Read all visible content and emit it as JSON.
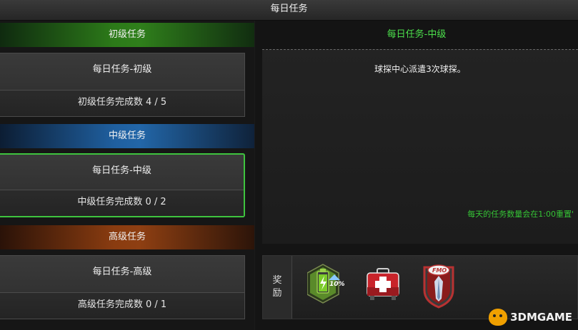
{
  "window": {
    "title": "每日任务"
  },
  "tiers": [
    {
      "header": "初级任务",
      "task_name": "每日任务-初级",
      "progress_label": "初级任务完成数 4 / 5",
      "completed": 4,
      "total": 5,
      "selected": false,
      "color": "#2f7f1b"
    },
    {
      "header": "中级任务",
      "task_name": "每日任务-中级",
      "progress_label": "中级任务完成数 0 / 2",
      "completed": 0,
      "total": 2,
      "selected": true,
      "color": "#2266a8"
    },
    {
      "header": "高级任务",
      "task_name": "每日任务-高级",
      "progress_label": "高级任务完成数 0 / 1",
      "completed": 0,
      "total": 1,
      "selected": false,
      "color": "#8e3f12"
    }
  ],
  "detail": {
    "title": "每日任务-中级",
    "description": "球探中心派遣3次球探。",
    "reset_note": "每天的任务数量会在1:00重置'"
  },
  "rewards": {
    "label_line1": "奖",
    "label_line2": "励",
    "items": [
      {
        "icon": "battery-boost-icon",
        "badge": "10%"
      },
      {
        "icon": "medical-kit-icon"
      },
      {
        "icon": "fmo-badge-icon",
        "badge": "FMO"
      }
    ]
  },
  "watermark": {
    "text": "3DMGAME"
  },
  "colors": {
    "accent_green": "#3ec43e",
    "text_green": "#4ce04c"
  }
}
